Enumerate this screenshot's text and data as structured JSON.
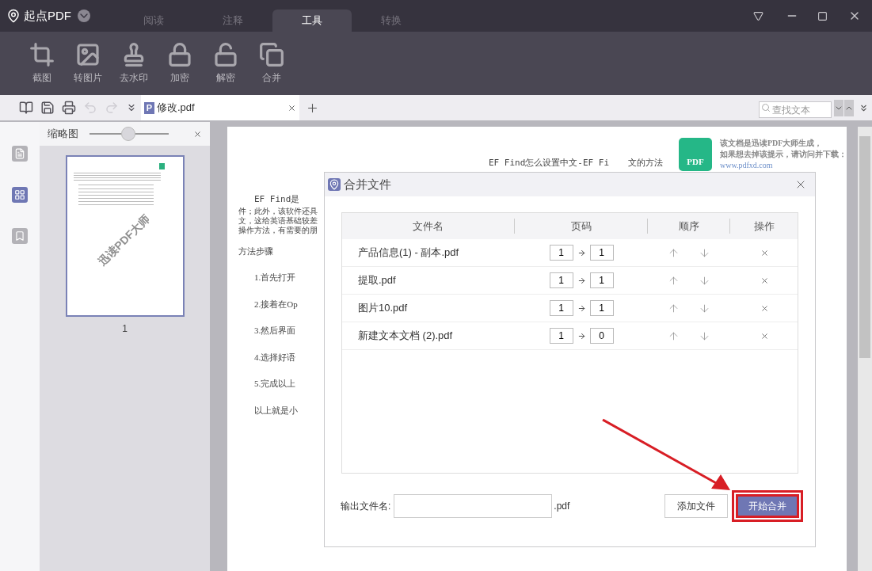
{
  "app": {
    "name": "起点PDF"
  },
  "menu_tabs": [
    {
      "label": "阅读",
      "selected": false
    },
    {
      "label": "注释",
      "selected": false
    },
    {
      "label": "工具",
      "selected": true
    },
    {
      "label": "转换",
      "selected": false
    }
  ],
  "tools": [
    {
      "kind": "crop",
      "label": "截图"
    },
    {
      "kind": "image",
      "label": "转图片"
    },
    {
      "kind": "watermark",
      "label": "去水印"
    },
    {
      "kind": "lock",
      "label": "加密"
    },
    {
      "kind": "unlock",
      "label": "解密"
    },
    {
      "kind": "merge",
      "label": "合并"
    }
  ],
  "quick_buttons": [
    {
      "kind": "book",
      "disabled": false
    },
    {
      "kind": "save",
      "disabled": false
    },
    {
      "kind": "print",
      "disabled": false
    },
    {
      "kind": "undo",
      "disabled": true
    },
    {
      "kind": "redo",
      "disabled": true
    }
  ],
  "file_tab": {
    "badge": "P",
    "name": "修改.pdf",
    "selected": true
  },
  "search": {
    "placeholder": "查找文本"
  },
  "sidebar": {
    "items": [
      {
        "kind": "outline",
        "selected": false
      },
      {
        "kind": "thumbnails",
        "selected": true
      },
      {
        "kind": "bookmarks",
        "selected": false
      }
    ]
  },
  "thumbnail_panel": {
    "title": "缩略图",
    "zoom": {
      "level": 0.49
    },
    "pages": [
      {
        "number": "1",
        "watermark": "迅读PDF大师",
        "selected": true
      }
    ]
  },
  "document": {
    "logo": "PDF",
    "notice": [
      "该文档是迅读PDF大师生成，",
      "如果想去掉该提示，请访问并下载：",
      "www.pdfxd.com"
    ],
    "title": [
      "EF Find怎么设置中文-EF Fi",
      "文的方法"
    ],
    "intro": [
      "EF Find是",
      "件；此外，该软件还具",
      "文，这给英语基础较差",
      "操作方法，有需要的朋"
    ],
    "heading": "方法步骤",
    "steps": [
      "1.首先打开",
      "2.接着在Op",
      "3.然后界面",
      "4.选择好语",
      "5.完成以上"
    ],
    "closing": "以上就是小"
  },
  "dialog": {
    "title": "合并文件",
    "columns": [
      "文件名",
      "页码",
      "顺序",
      "操作"
    ],
    "rows": [
      {
        "name": "产品信息(1) - 副本.pdf",
        "from": "1",
        "to": "1"
      },
      {
        "name": "提取.pdf",
        "from": "1",
        "to": "1"
      },
      {
        "name": "图片10.pdf",
        "from": "1",
        "to": "1"
      },
      {
        "name": "新建文本文档 (2).pdf",
        "from": "1",
        "to": "0"
      }
    ],
    "output_label": "输出文件名:",
    "output_suffix": ".pdf",
    "buttons": [
      {
        "label": "添加文件",
        "primary": false,
        "highlighted": false
      },
      {
        "label": "开始合并",
        "primary": true,
        "highlighted": true
      }
    ]
  }
}
